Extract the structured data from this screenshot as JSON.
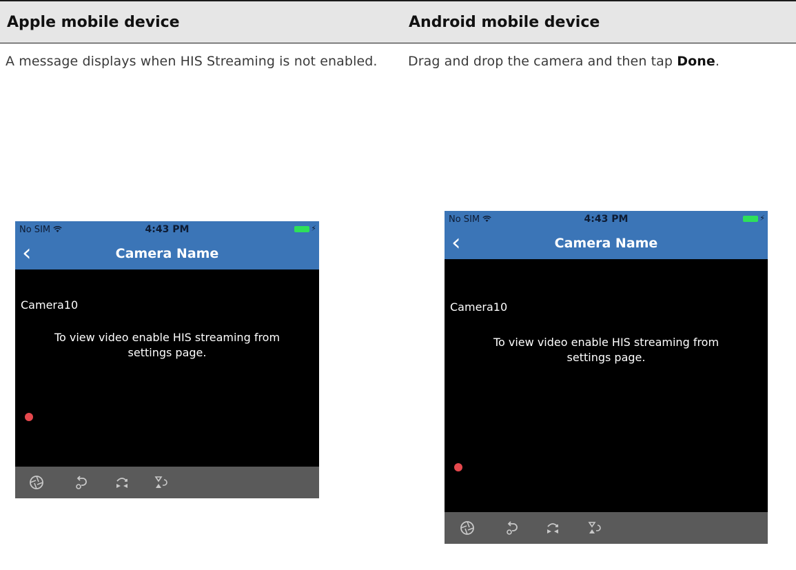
{
  "columns": {
    "left_heading": "Apple mobile device",
    "right_heading": "Android mobile device"
  },
  "descriptions": {
    "left": "A message displays when HIS Streaming is not enabled.",
    "right_prefix": "Drag and drop the camera and then tap ",
    "right_bold": "Done",
    "right_suffix": "."
  },
  "phones": [
    {
      "status": {
        "carrier": "No SIM",
        "time": "4:43 PM"
      },
      "nav_title": "Camera Name",
      "camera_label": "Camera10",
      "message": "To view video enable HIS streaming from settings page."
    },
    {
      "status": {
        "carrier": "No SIM",
        "time": "4:43 PM"
      },
      "nav_title": "Camera Name",
      "camera_label": "Camera10",
      "message": "To view video enable HIS streaming from settings page."
    }
  ],
  "colors": {
    "nav_blue": "#3b75b7",
    "battery_green": "#2ee05a",
    "record_dot": "#e5484d",
    "toolbar_gray": "#5a5a5a"
  },
  "icons": [
    "aperture-icon",
    "rotate-icon",
    "swap-icon",
    "flip-icon"
  ]
}
